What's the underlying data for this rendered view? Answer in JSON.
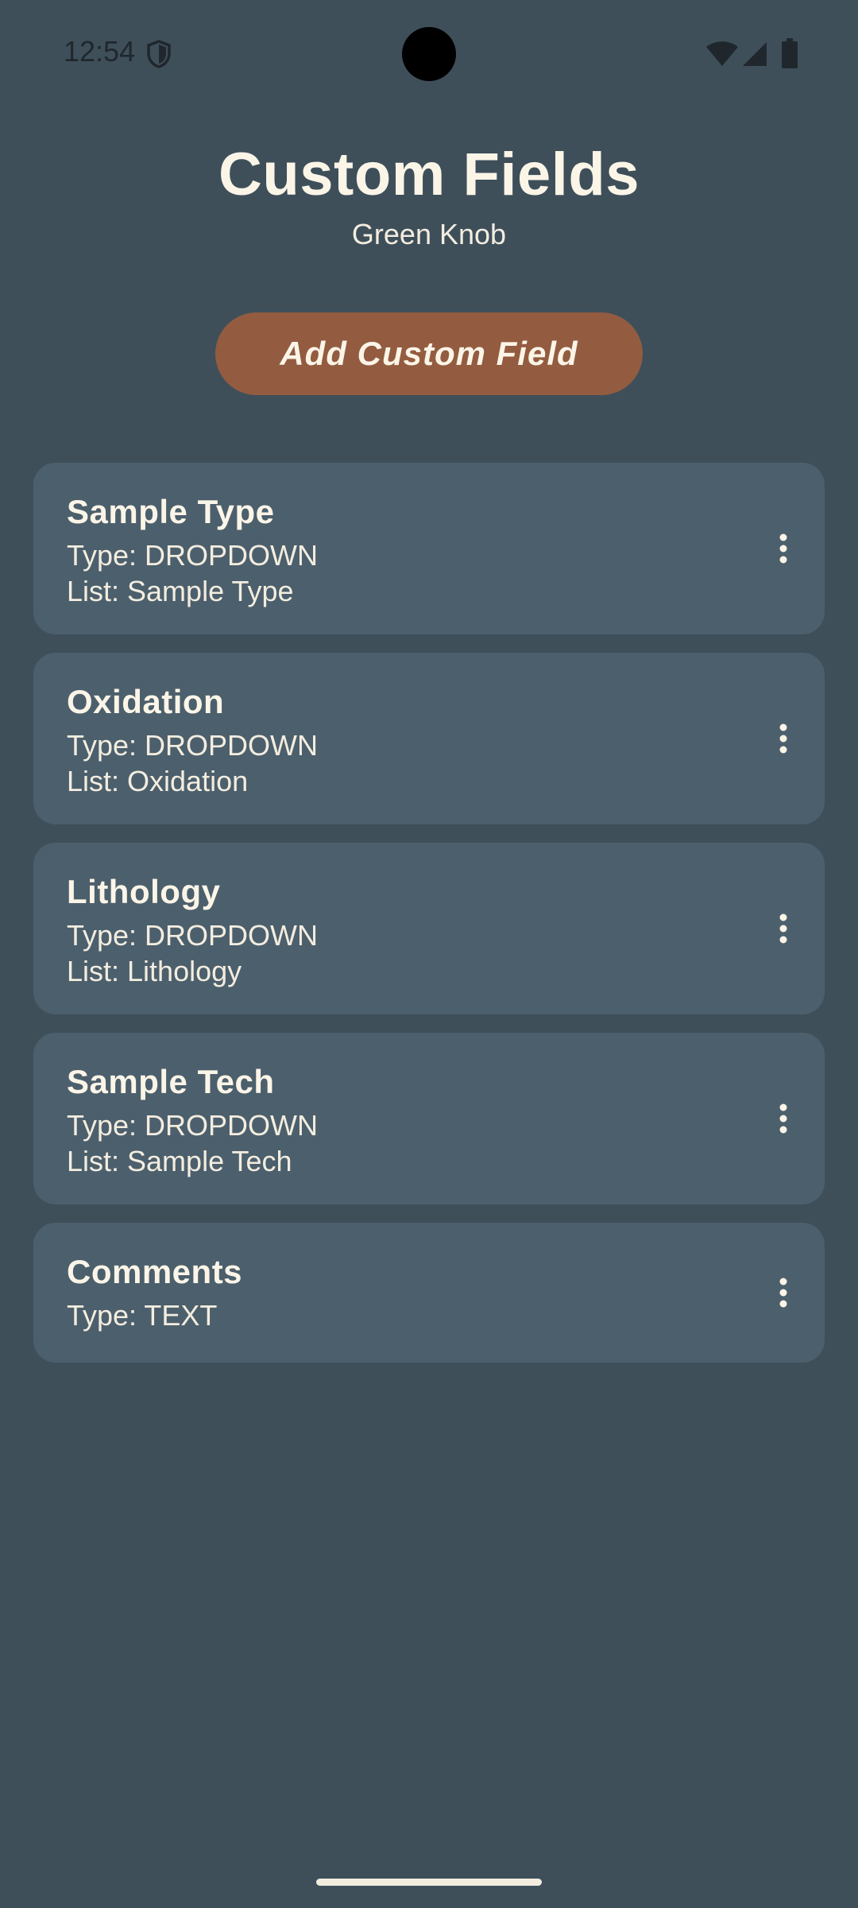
{
  "status_bar": {
    "time": "12:54",
    "icons": [
      "shield-icon",
      "wifi-icon",
      "signal-icon",
      "battery-icon"
    ]
  },
  "header": {
    "title": "Custom Fields",
    "subtitle": "Green Knob"
  },
  "add_button": {
    "label": "Add Custom Field"
  },
  "fields": [
    {
      "name": "Sample Type",
      "type": "Type: DROPDOWN",
      "list": "List: Sample Type"
    },
    {
      "name": "Oxidation",
      "type": "Type: DROPDOWN",
      "list": "List: Oxidation"
    },
    {
      "name": "Lithology",
      "type": "Type: DROPDOWN",
      "list": "List: Lithology"
    },
    {
      "name": "Sample Tech",
      "type": "Type: DROPDOWN",
      "list": "List: Sample Tech"
    },
    {
      "name": "Comments",
      "type": "Type: TEXT"
    }
  ],
  "colors": {
    "background": "#3e4f5a",
    "card": "#4c5f6c",
    "accent": "#935c40",
    "text": "#fbf5e8"
  }
}
